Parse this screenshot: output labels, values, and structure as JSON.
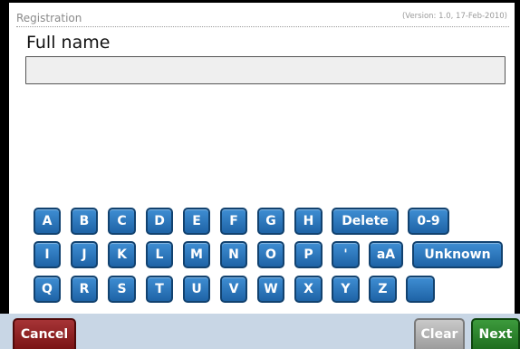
{
  "header": {
    "title": "Registration",
    "version": "(Version: 1.0, 17-Feb-2010)"
  },
  "field": {
    "label": "Full name",
    "value": ""
  },
  "keyboard": {
    "row1": [
      "A",
      "B",
      "C",
      "D",
      "E",
      "F",
      "G",
      "H",
      "Delete",
      "0-9"
    ],
    "row2": [
      "I",
      "J",
      "K",
      "L",
      "M",
      "N",
      "O",
      "P",
      "'",
      "aA",
      "Unknown"
    ],
    "row3": [
      "Q",
      "R",
      "S",
      "T",
      "U",
      "V",
      "W",
      "X",
      "Y",
      "Z",
      ""
    ]
  },
  "buttons": {
    "cancel": "Cancel",
    "clear": "Clear",
    "next": "Next"
  },
  "colors": {
    "key": "#2a74bb",
    "cancel": "#8e2224",
    "clear": "#b0b0b0",
    "next": "#2a842a",
    "bottom_bar": "#c8d6e5"
  }
}
